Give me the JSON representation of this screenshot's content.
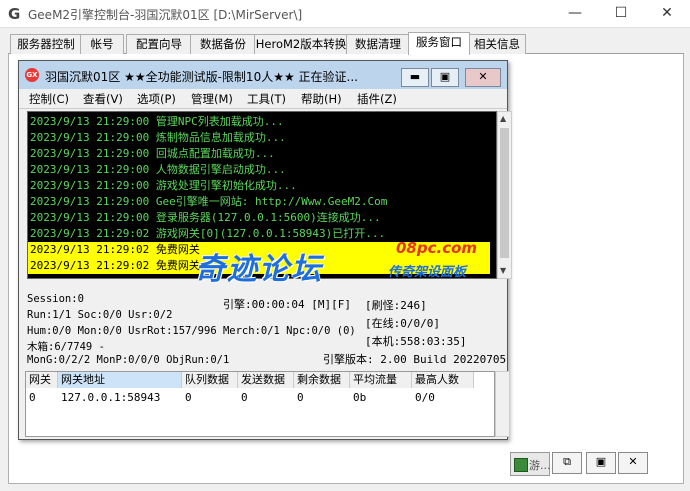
{
  "window": {
    "logo": "G",
    "title": "GeeM2引擎控制台-羽国沉默01区 [D:\\MirServer\\]",
    "minimize": "—",
    "maximize": "☐",
    "close": "✕"
  },
  "tabs": [
    {
      "label": "服务器控制"
    },
    {
      "label": "帐号"
    },
    {
      "label": "配置向导"
    },
    {
      "label": "数据备份"
    },
    {
      "label": "HeroM2版本转换"
    },
    {
      "label": "数据清理"
    },
    {
      "label": "服务窗口"
    },
    {
      "label": "相关信息"
    }
  ],
  "inner": {
    "icon_label": "GX",
    "title": "羽国沉默01区  ★★全功能测试版-限制10人★★  正在验证...",
    "minimize": "▬",
    "maximize": "▣",
    "close": "✕",
    "menu": [
      {
        "label": "控制(C)"
      },
      {
        "label": "查看(V)"
      },
      {
        "label": "选项(P)"
      },
      {
        "label": "管理(M)"
      },
      {
        "label": "工具(T)"
      },
      {
        "label": "帮助(H)"
      },
      {
        "label": "插件(Z)"
      }
    ],
    "log": [
      {
        "text": "2023/9/13 21:29:00 管理NPC列表加载成功..."
      },
      {
        "text": "2023/9/13 21:29:00 炼制物品信息加载成功..."
      },
      {
        "text": "2023/9/13 21:29:00 回城点配置加载成功..."
      },
      {
        "text": "2023/9/13 21:29:00 人物数据引擎启动成功..."
      },
      {
        "text": "2023/9/13 21:29:00 游戏处理引擎初始化成功..."
      },
      {
        "text": "2023/9/13 21:29:00 Gee引擎唯一网站: http://Www.GeeM2.Com"
      },
      {
        "text": "2023/9/13 21:29:00 登录服务器(127.0.0.1:5600)连接成功..."
      },
      {
        "text": "2023/9/13 21:29:02 游戏网关[0](127.0.0.1:58943)已打开..."
      },
      {
        "text": "2023/9/13 21:29:02 免费网关",
        "highlight": true
      },
      {
        "text": "2023/9/13 21:29:02 免费网关",
        "highlight": true
      }
    ],
    "status": {
      "session": "Session:0",
      "run": "Run:1/1 Soc:0/0 Usr:0/2",
      "hum": "Hum:0/0 Mon:0/0 UsrRot:157/996 Merch:0/1 Npc:0/0 (0)",
      "box": "木箱:6/7749 -",
      "mong": "MonG:0/2/2 MonP:0/0/0 ObjRun:0/1",
      "engine": "引擎:00:00:04 [M][F]",
      "refresh": "[刷怪:246]",
      "online": "[在线:0/0/0]",
      "local": "[本机:558:03:35]",
      "version": "引擎版本: 2.00 Build 20220705"
    },
    "grid": {
      "headers": [
        "网关",
        "网关地址",
        "队列数据",
        "发送数据",
        "剩余数据",
        "平均流量",
        "最高人数"
      ],
      "rows": [
        [
          "0",
          "127.0.0.1:58943",
          "0",
          "0",
          "0",
          "0b",
          "0/0"
        ]
      ]
    }
  },
  "watermark": {
    "main": "奇迹论坛",
    "url": "08pc.com",
    "sub": "传奇架设面板"
  },
  "taskbar": {
    "item": "游...",
    "btn1": "⧉",
    "btn2": "▣",
    "btn3": "✕"
  },
  "colors": {
    "log_text": "#5cd65c",
    "log_bg": "#000000",
    "highlight": "#ffff00",
    "inner_title": "#bcd4ec"
  }
}
